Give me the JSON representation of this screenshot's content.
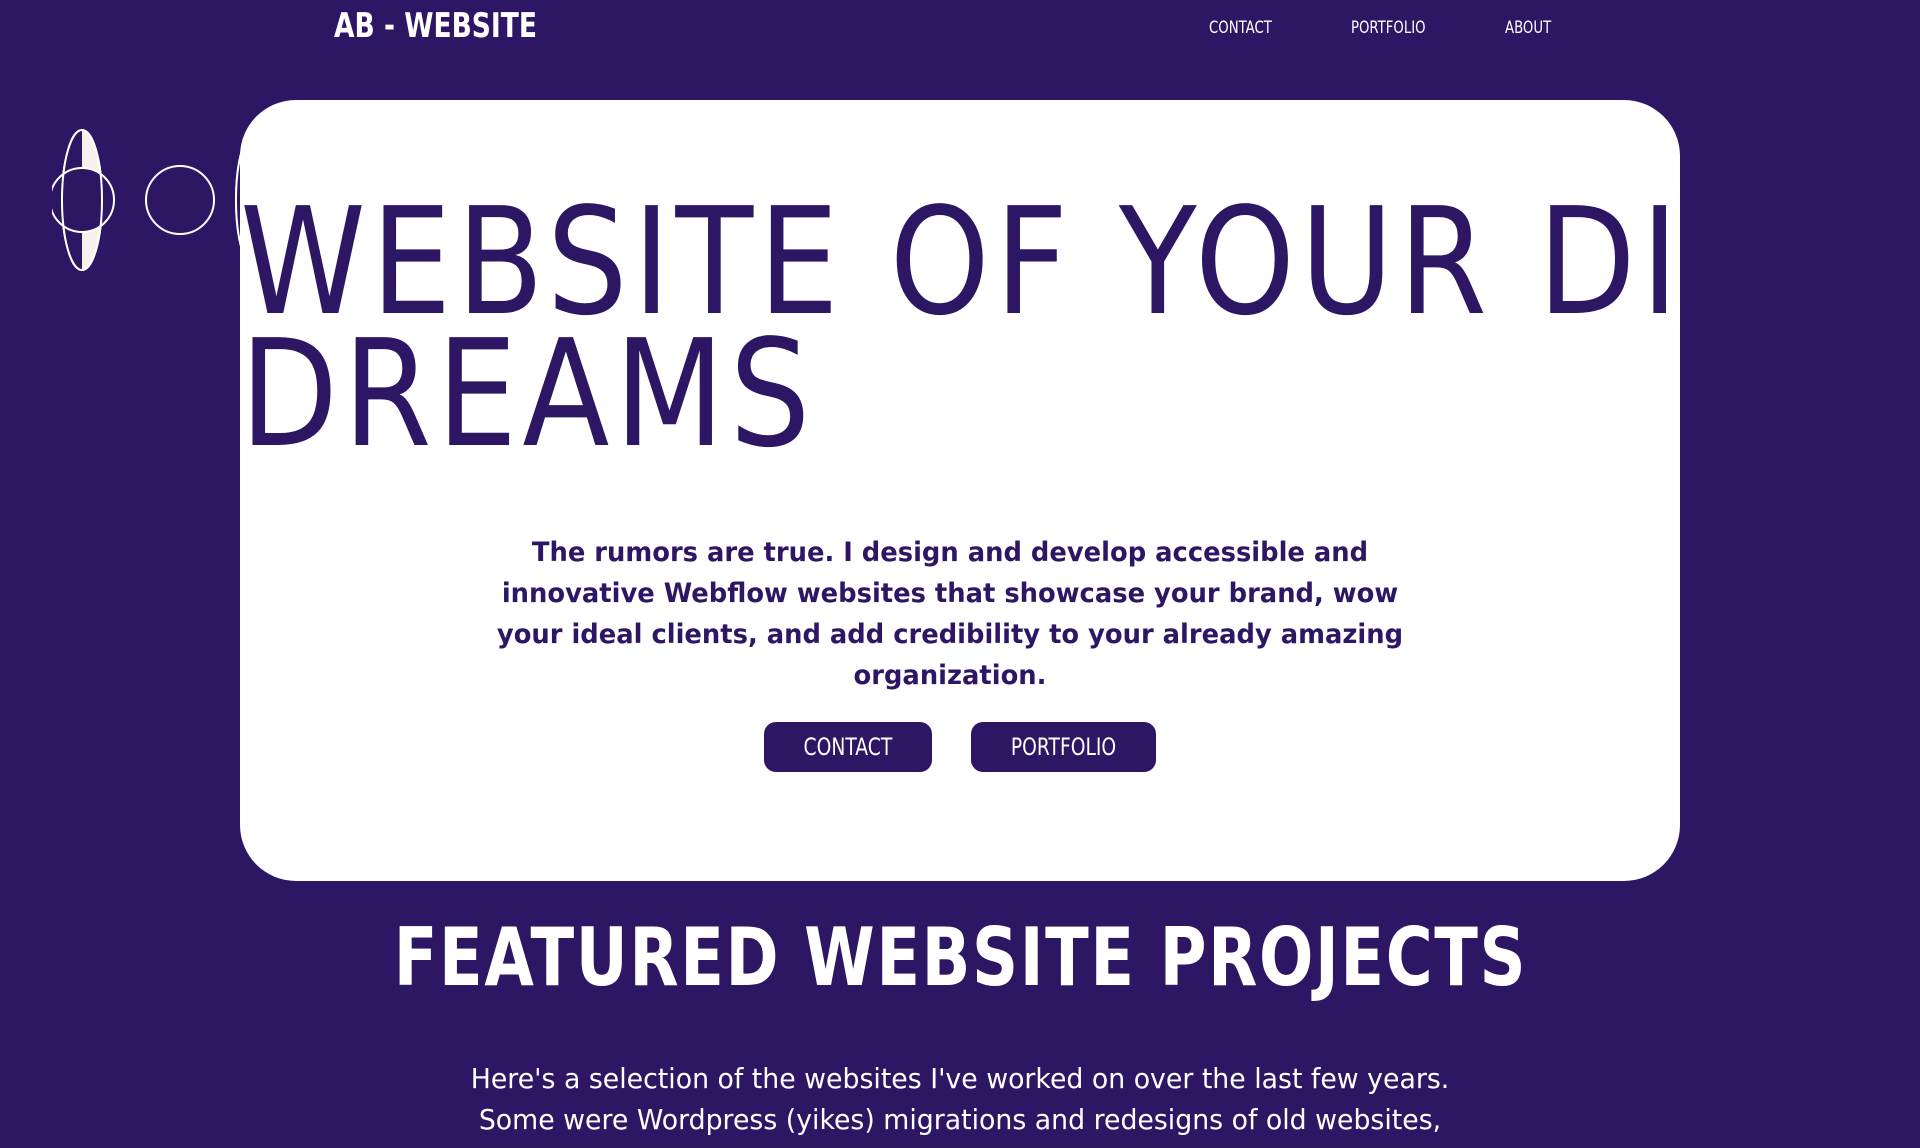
{
  "header": {
    "logo": "AB - WEBSITE",
    "nav": {
      "contact": "CONTACT",
      "portfolio": "PORTFOLIO",
      "about": "ABOUT"
    }
  },
  "hero": {
    "title_line1": "WEBSITE OF YOUR DIGITAL",
    "title_line2": "DREAMS",
    "description": "The rumors are true. I design and develop accessible and innovative Webflow websites that showcase your brand, wow your ideal clients, and add credibility to your already amazing organization.",
    "buttons": {
      "contact": "CONTACT",
      "portfolio": "PORTFOLIO"
    },
    "illustration": "greek-column-icon"
  },
  "featured": {
    "title": "FEATURED WEBSITE PROJECTS",
    "intro": "Here's a selection of the websites I've worked on over the last few years. Some were Wordpress (yikes) migrations and redesigns of old websites,"
  },
  "colors": {
    "background": "#2d1764",
    "card": "#ffffff",
    "accent_light": "#f7f0ef"
  }
}
